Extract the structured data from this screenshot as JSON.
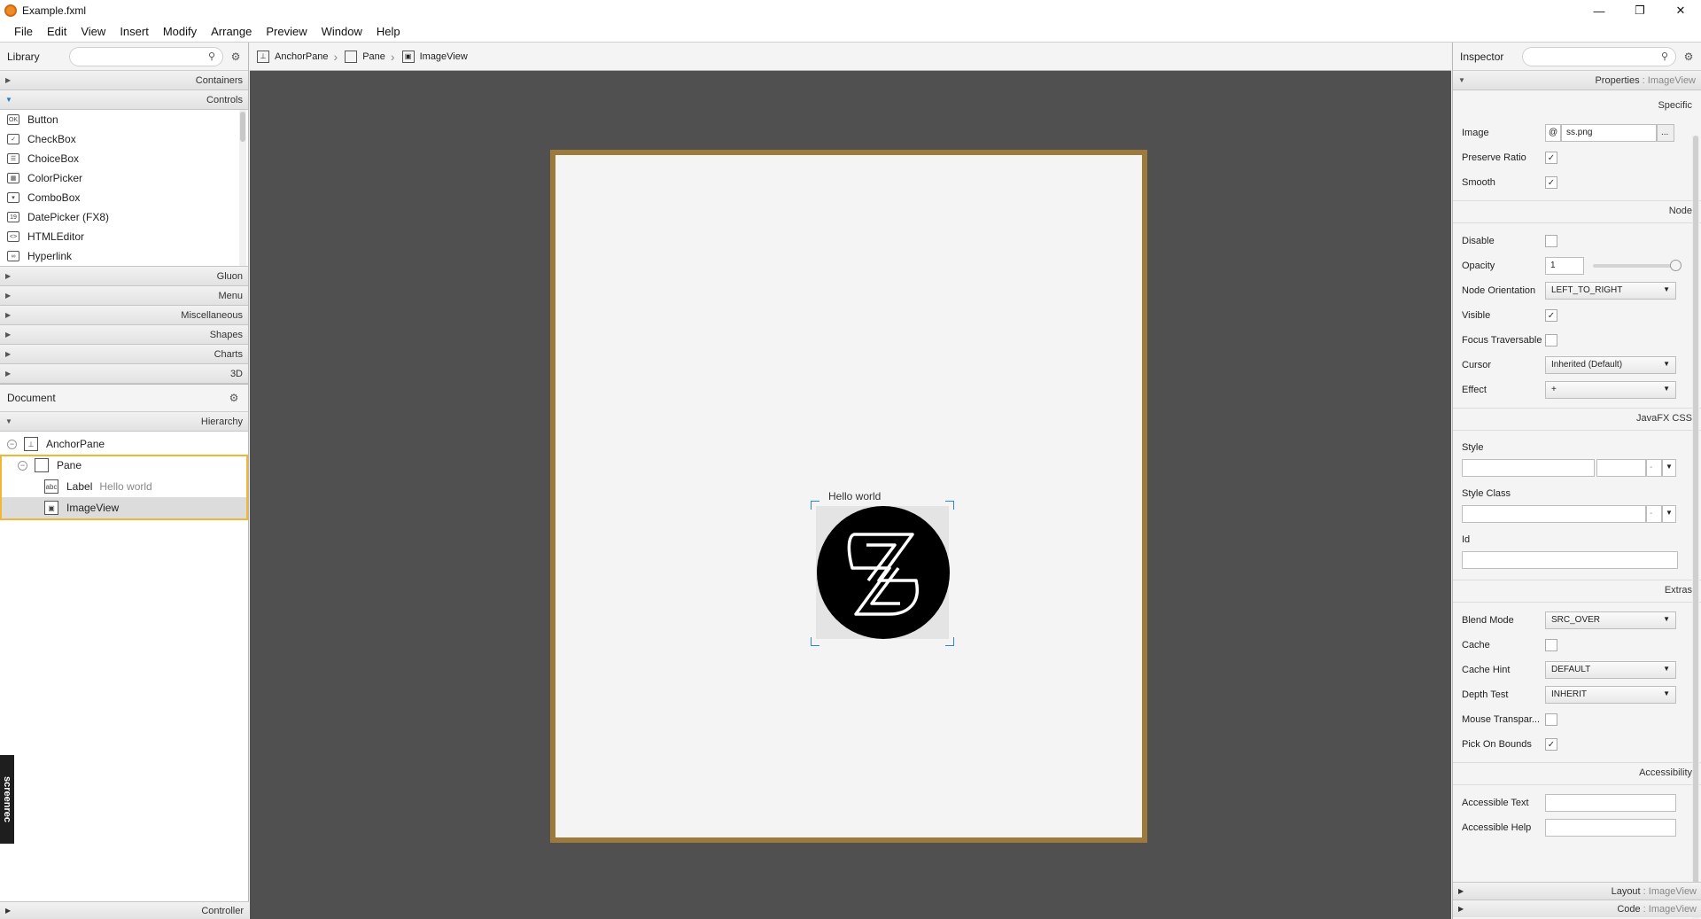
{
  "window": {
    "title": "Example.fxml",
    "minimize": "—",
    "restore": "❐",
    "close": "✕"
  },
  "menu": [
    "File",
    "Edit",
    "View",
    "Insert",
    "Modify",
    "Arrange",
    "Preview",
    "Window",
    "Help"
  ],
  "library": {
    "title": "Library",
    "search_icon": "⚲",
    "sections_top": [
      {
        "label": "Containers",
        "open": false
      },
      {
        "label": "Controls",
        "open": true
      }
    ],
    "controls": [
      {
        "label": "Button",
        "icon": "OK"
      },
      {
        "label": "CheckBox",
        "icon": "✓"
      },
      {
        "label": "ChoiceBox",
        "icon": "☰"
      },
      {
        "label": "ColorPicker",
        "icon": "▦"
      },
      {
        "label": "ComboBox",
        "icon": "▾"
      },
      {
        "label": "DatePicker  (FX8)",
        "icon": "19"
      },
      {
        "label": "HTMLEditor",
        "icon": "<>"
      },
      {
        "label": "Hyperlink",
        "icon": "∞"
      }
    ],
    "sections_bottom": [
      "Gluon",
      "Menu",
      "Miscellaneous",
      "Shapes",
      "Charts",
      "3D"
    ]
  },
  "document": {
    "title": "Document",
    "hierarchy_label": "Hierarchy",
    "tree": {
      "anchorpane": "AnchorPane",
      "pane": "Pane",
      "label_type": "Label",
      "label_text": "Hello world",
      "imageview": "ImageView"
    },
    "controller_label": "Controller"
  },
  "breadcrumb": [
    "AnchorPane",
    "Pane",
    "ImageView"
  ],
  "canvas": {
    "label_text": "Hello world"
  },
  "inspector": {
    "title": "Inspector",
    "properties_header": "Properties",
    "properties_sub": ": ImageView",
    "specific": "Specific",
    "image_label": "Image",
    "image_value": "ss.png",
    "image_at": "@",
    "image_browse": "...",
    "preserve_ratio": "Preserve Ratio",
    "smooth": "Smooth",
    "node": "Node",
    "disable": "Disable",
    "opacity": "Opacity",
    "opacity_value": "1",
    "node_orientation": "Node Orientation",
    "node_orientation_value": "LEFT_TO_RIGHT",
    "visible": "Visible",
    "focus_traversable": "Focus Traversable",
    "cursor": "Cursor",
    "cursor_value": "Inherited (Default)",
    "effect": "Effect",
    "effect_value": "+",
    "javafx_css": "JavaFX CSS",
    "style": "Style",
    "style_class": "Style Class",
    "id": "Id",
    "extras": "Extras",
    "blend_mode": "Blend Mode",
    "blend_mode_value": "SRC_OVER",
    "cache": "Cache",
    "cache_hint": "Cache Hint",
    "cache_hint_value": "DEFAULT",
    "depth_test": "Depth Test",
    "depth_test_value": "INHERIT",
    "mouse_transparent": "Mouse Transpar...",
    "pick_on_bounds": "Pick On Bounds",
    "accessibility": "Accessibility",
    "accessible_text": "Accessible Text",
    "accessible_help": "Accessible Help",
    "layout_header": "Layout",
    "layout_sub": ": ImageView",
    "code_header": "Code",
    "code_sub": ": ImageView"
  },
  "screenrec": "screenrec",
  "colors": {
    "stage_border": "#9c7a3c",
    "canvas_bg": "#505050",
    "selection": "#f2b636",
    "handles": "#2b86d9"
  }
}
